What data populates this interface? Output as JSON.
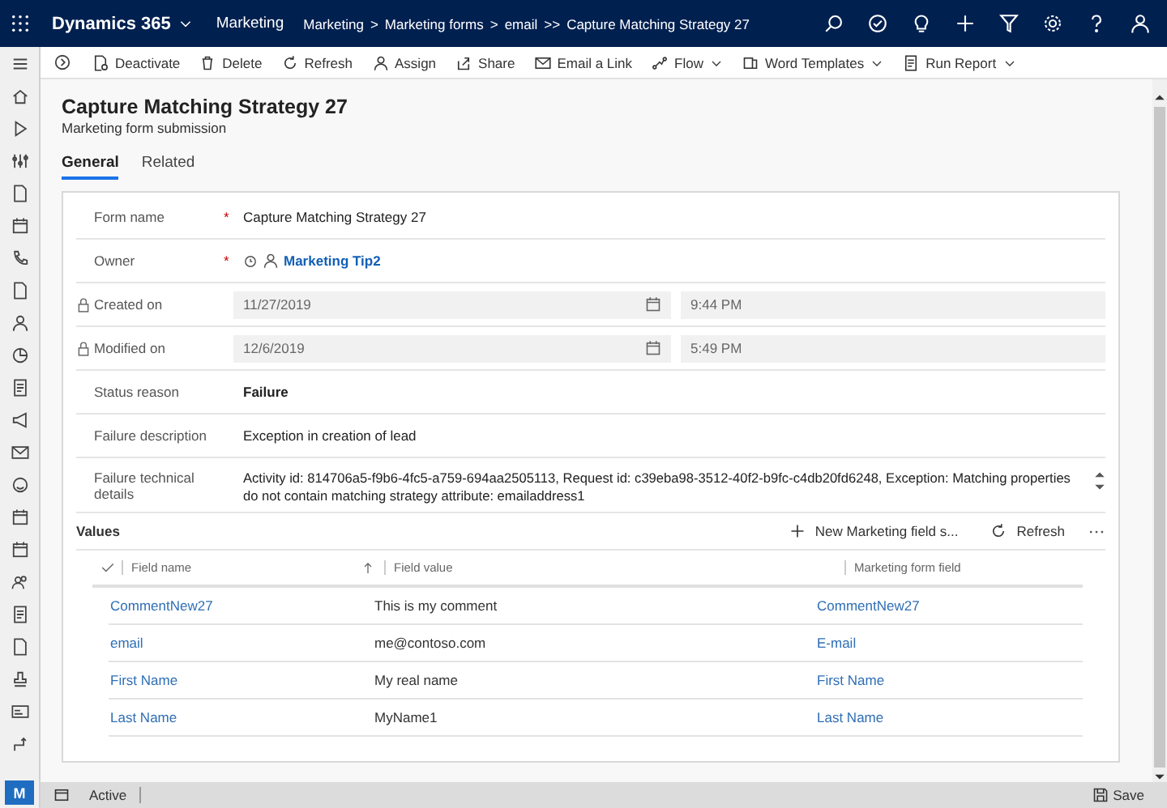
{
  "app": {
    "title": "Dynamics 365",
    "area": "Marketing"
  },
  "breadcrumb": {
    "items": [
      "Marketing",
      "Marketing forms",
      "email",
      "Capture Matching Strategy 27"
    ],
    "separators": [
      ">",
      ">",
      ">>"
    ]
  },
  "commands": [
    {
      "label": "Deactivate",
      "dropdown": false
    },
    {
      "label": "Delete",
      "dropdown": false
    },
    {
      "label": "Refresh",
      "dropdown": false
    },
    {
      "label": "Assign",
      "dropdown": false
    },
    {
      "label": "Share",
      "dropdown": false
    },
    {
      "label": "Email a Link",
      "dropdown": false
    },
    {
      "label": "Flow",
      "dropdown": true
    },
    {
      "label": "Word Templates",
      "dropdown": true
    },
    {
      "label": "Run Report",
      "dropdown": true
    }
  ],
  "record": {
    "title": "Capture Matching Strategy 27",
    "subtitle": "Marketing form submission"
  },
  "tabs": [
    {
      "label": "General",
      "selected": true
    },
    {
      "label": "Related",
      "selected": false
    }
  ],
  "fields": [
    {
      "kind": "text",
      "label": "Form name",
      "required_mark": "*",
      "emphasis": false,
      "value": "Capture Matching Strategy 27"
    },
    {
      "kind": "lookup",
      "label": "Owner",
      "required_mark": "*",
      "value": "Marketing Tip2"
    },
    {
      "kind": "datetime",
      "label": "Created on",
      "locked": true,
      "date": "11/27/2019",
      "time": "9:44 PM"
    },
    {
      "kind": "datetime",
      "label": "Modified on",
      "locked": true,
      "date": "12/6/2019",
      "time": "5:49 PM"
    },
    {
      "kind": "text",
      "label": "Status reason",
      "emphasis": true,
      "value": "Failure"
    },
    {
      "kind": "text",
      "label": "Failure description",
      "emphasis": false,
      "value": "Exception in creation of lead"
    },
    {
      "kind": "multiline",
      "label": "Failure technical details",
      "value": "Activity id: 814706a5-f9b6-4fc5-a759-694aa2505113, Request id: c39eba98-3512-40f2-b9fc-c4db20fd6248, Exception: Matching properties do not contain matching strategy attribute: emailaddress1"
    }
  ],
  "values": {
    "title": "Values",
    "actions": [
      {
        "kind": "new",
        "label": "New Marketing field s..."
      },
      {
        "kind": "refresh",
        "label": "Refresh"
      }
    ],
    "columns": [
      {
        "label": "Field name",
        "sorted": true
      },
      {
        "label": "Field value",
        "sorted": false
      },
      {
        "label": "Marketing form field",
        "sorted": false
      }
    ],
    "rows": [
      [
        "CommentNew27",
        "This is my comment",
        "CommentNew27"
      ],
      [
        "email",
        "me@contoso.com",
        "E-mail"
      ],
      [
        "First Name",
        "My real name",
        "First Name"
      ],
      [
        "Last Name",
        "MyName1",
        "Last Name"
      ]
    ]
  },
  "rail": {
    "avatar": "M"
  },
  "status_bar": {
    "status": "Active",
    "save": "Save"
  }
}
